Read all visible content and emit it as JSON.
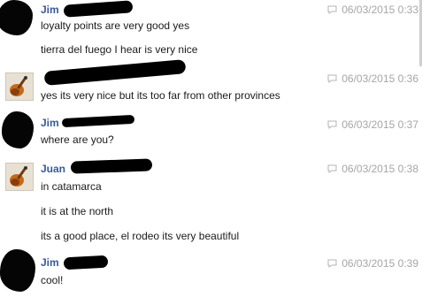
{
  "messages": [
    {
      "author": "Jim",
      "timestamp": "06/03/2015 0:33",
      "avatar_icon": "redacted-profile-picture",
      "lines": [
        "loyalty points are very good yes",
        "tierra del fuego I hear is very nice"
      ]
    },
    {
      "author": "",
      "timestamp": "06/03/2015 0:36",
      "avatar_icon": "guitar-profile-picture",
      "lines": [
        "yes its very nice but its too far from other provinces"
      ]
    },
    {
      "author": "Jim",
      "timestamp": "06/03/2015 0:37",
      "avatar_icon": "redacted-profile-picture",
      "lines": [
        "where are you?"
      ]
    },
    {
      "author": "Juan",
      "timestamp": "06/03/2015 0:38",
      "avatar_icon": "guitar-profile-picture",
      "lines": [
        "in catamarca",
        "it is at the north",
        "its a good place, el rodeo its very beautiful"
      ]
    },
    {
      "author": "Jim",
      "timestamp": "06/03/2015 0:39",
      "avatar_icon": "redacted-profile-picture",
      "lines": [
        "cool!"
      ]
    }
  ],
  "colors": {
    "author_name": "#3b5998",
    "timestamp": "#a6a6a6",
    "message_text": "#1a1a1a",
    "redaction": "#000000"
  }
}
